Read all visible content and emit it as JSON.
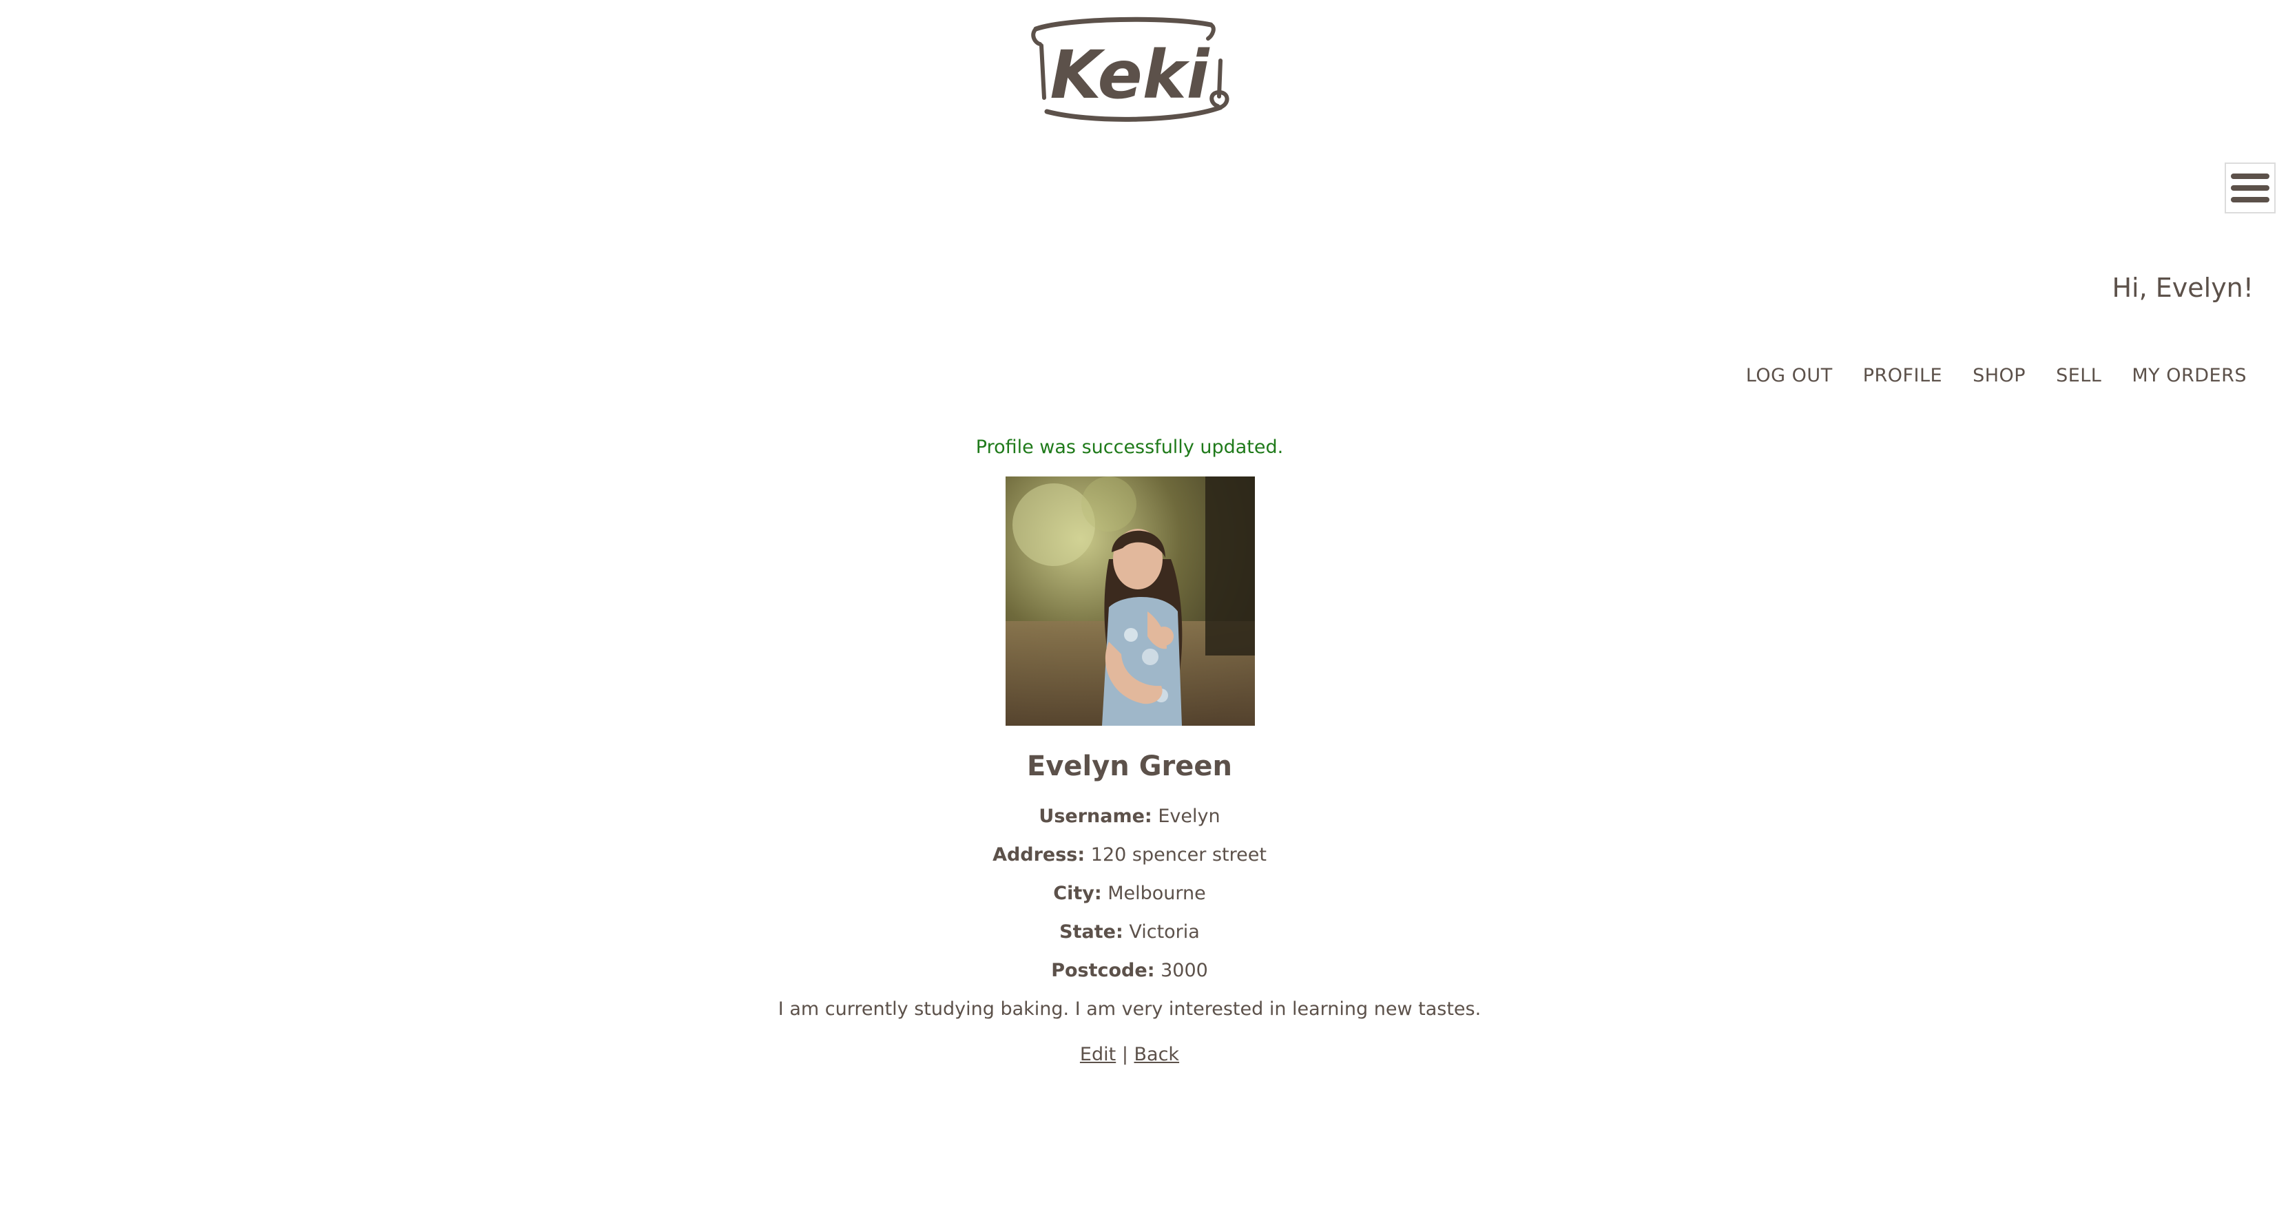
{
  "header": {
    "logo_text": "Keki",
    "greeting": "Hi, Evelyn!"
  },
  "nav": {
    "items": [
      {
        "label": "LOG OUT"
      },
      {
        "label": "PROFILE"
      },
      {
        "label": "SHOP"
      },
      {
        "label": "SELL"
      },
      {
        "label": "MY ORDERS"
      }
    ]
  },
  "notice": "Profile was successfully updated.",
  "profile": {
    "name": "Evelyn Green",
    "fields": [
      {
        "label": "Username:",
        "value": "Evelyn"
      },
      {
        "label": "Address:",
        "value": "120 spencer street"
      },
      {
        "label": "City:",
        "value": "Melbourne"
      },
      {
        "label": "State:",
        "value": "Victoria"
      },
      {
        "label": "Postcode:",
        "value": "3000"
      }
    ],
    "bio": "I am currently studying baking. I am very interested in learning new tastes."
  },
  "actions": {
    "edit": "Edit",
    "separator": "|",
    "back": "Back"
  },
  "colors": {
    "text": "#5c514a",
    "notice": "#1f7a1a",
    "background": "#ffffff"
  },
  "icons": {
    "menu": "hamburger-menu-icon"
  }
}
